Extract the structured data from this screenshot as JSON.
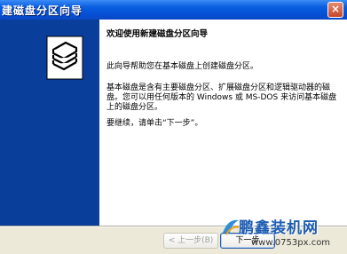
{
  "window": {
    "title": "建磁盘分区向导",
    "close_glyph": "×"
  },
  "wizard": {
    "heading": "欢迎使用新建磁盘分区向导",
    "intro": "此向导帮助您在基本磁盘上创建磁盘分区。",
    "explanation": "基本磁盘是含有主要磁盘分区、扩展磁盘分区和逻辑驱动器的磁盘。您可以用任何版本的 Windows 或 MS-DOS 来访问基本磁盘上的磁盘分区。",
    "continue_prompt": "要继续，请单击“下一步”。"
  },
  "buttons": {
    "back_label": "< 上一步(B)",
    "next_label": "下一步"
  },
  "watermark": {
    "brand": "鹏鑫装机网",
    "url": "www.0753px.com"
  }
}
